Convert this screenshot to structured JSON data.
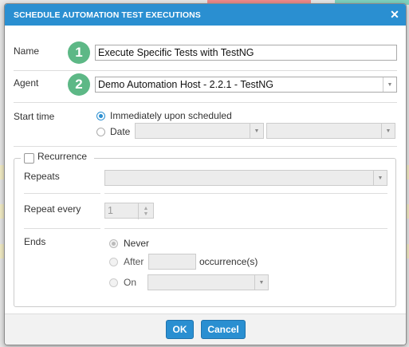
{
  "dialog": {
    "title": "SCHEDULE AUTOMATION TEST EXECUTIONS",
    "close_icon": "close-icon"
  },
  "name": {
    "label": "Name",
    "badge": "1",
    "value": "Execute Specific Tests with TestNG"
  },
  "agent": {
    "label": "Agent",
    "badge": "2",
    "value": "Demo Automation Host - 2.2.1 - TestNG"
  },
  "start_time": {
    "label": "Start time",
    "option_immediately": "Immediately upon scheduled",
    "option_date": "Date",
    "selected": "immediately"
  },
  "recurrence": {
    "label": "Recurrence",
    "checked": false,
    "repeats_label": "Repeats",
    "repeat_every_label": "Repeat every",
    "repeat_every_value": "1",
    "ends_label": "Ends",
    "ends_never": "Never",
    "ends_after": "After",
    "ends_after_suffix": "occurrence(s)",
    "ends_on": "On",
    "ends_selected": "never"
  },
  "footer": {
    "ok_label": "OK",
    "cancel_label": "Cancel"
  },
  "colors": {
    "accent": "#2a8fd1",
    "badge": "#5db886"
  }
}
